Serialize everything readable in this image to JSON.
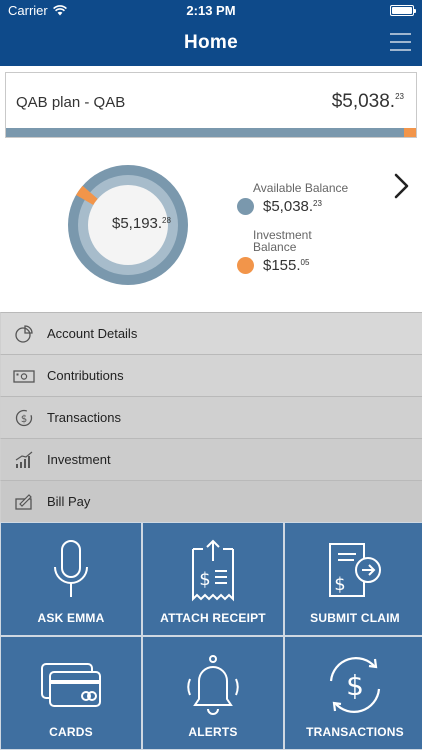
{
  "status": {
    "carrier": "Carrier",
    "time": "2:13 PM"
  },
  "nav": {
    "title": "Home"
  },
  "plan": {
    "name": "QAB plan - QAB",
    "amount_main": "$5,038.",
    "amount_cents": "23",
    "investment_fraction": 0.03
  },
  "donut": {
    "total_main": "$5,193.",
    "total_cents": "28",
    "available_fraction": 0.97,
    "investment_fraction": 0.03
  },
  "legend": {
    "available_label": "Available Balance",
    "available_main": "$5,038.",
    "available_cents": "23",
    "investment_label": "Investment Balance",
    "investment_main": "$155.",
    "investment_cents": "05"
  },
  "colors": {
    "nav": "#0e4a8a",
    "available": "#7a98ad",
    "investment": "#f2954a",
    "tile": "#3f6fa0"
  },
  "menu": [
    {
      "label": "Account Details",
      "icon": "pie-chart-icon"
    },
    {
      "label": "Contributions",
      "icon": "cash-icon"
    },
    {
      "label": "Transactions",
      "icon": "dollar-circle-icon"
    },
    {
      "label": "Investment",
      "icon": "growth-bars-icon"
    },
    {
      "label": "Bill Pay",
      "icon": "pen-check-icon"
    }
  ],
  "tiles": [
    {
      "label": "ASK EMMA",
      "icon": "microphone-icon"
    },
    {
      "label": "ATTACH RECEIPT",
      "icon": "receipt-icon"
    },
    {
      "label": "SUBMIT CLAIM",
      "icon": "submit-claim-icon"
    },
    {
      "label": "CARDS",
      "icon": "cards-icon"
    },
    {
      "label": "ALERTS",
      "icon": "bell-icon"
    },
    {
      "label": "TRANSACTIONS",
      "icon": "dollar-cycle-icon"
    }
  ]
}
